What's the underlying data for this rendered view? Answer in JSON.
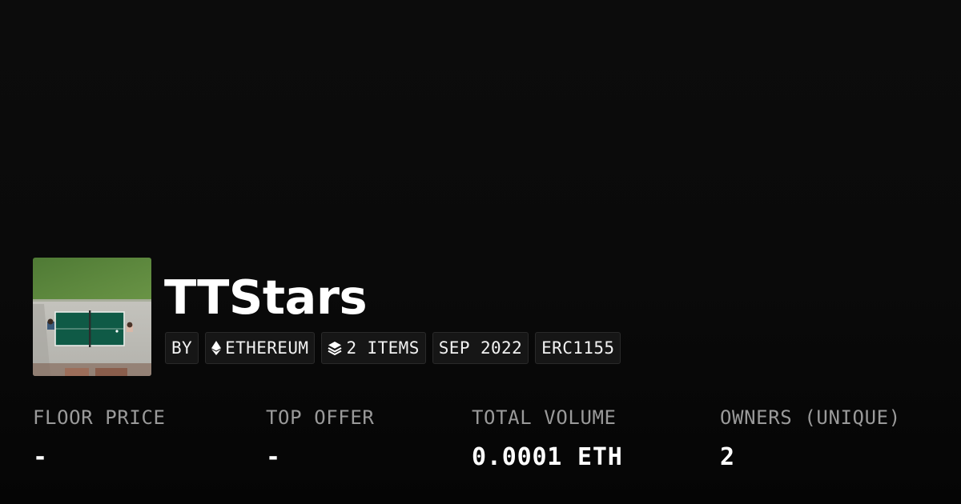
{
  "collection": {
    "name": "TTStars",
    "image_icon": "ping-pong-table-aerial-photo"
  },
  "badges": {
    "by": {
      "label": "BY"
    },
    "chain": {
      "label": "ETHEREUM",
      "icon": "ethereum-icon"
    },
    "items": {
      "label": "2 ITEMS",
      "icon": "layers-icon"
    },
    "date": {
      "label": "SEP 2022"
    },
    "standard": {
      "label": "ERC1155"
    }
  },
  "stats": {
    "floor_price": {
      "label": "FLOOR PRICE",
      "value": "-"
    },
    "top_offer": {
      "label": "TOP OFFER",
      "value": "-"
    },
    "total_volume": {
      "label": "TOTAL VOLUME",
      "value": "0.0001 ETH"
    },
    "owners": {
      "label": "OWNERS (UNIQUE)",
      "value": "2"
    }
  },
  "colors": {
    "background": "#0a0a0a",
    "badge_background": "#161616",
    "label_gray": "#9a9a9a",
    "text_white": "#ffffff"
  }
}
